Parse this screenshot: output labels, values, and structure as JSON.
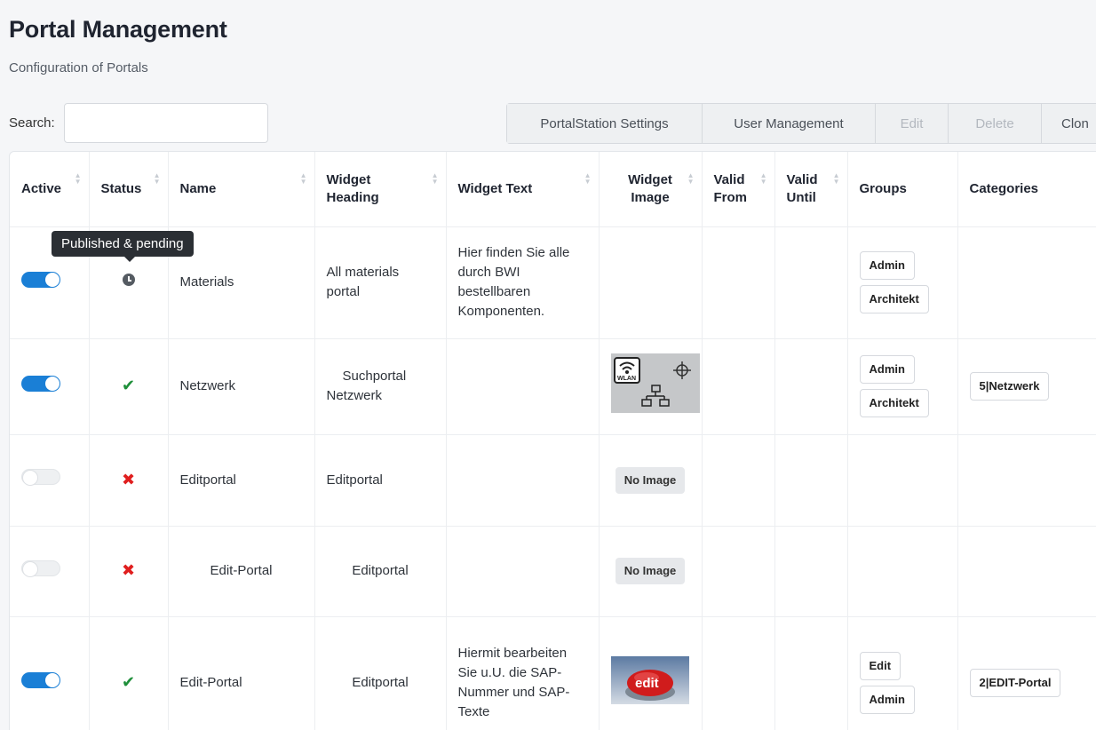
{
  "header": {
    "title": "Portal Management",
    "subtitle": "Configuration of Portals"
  },
  "search": {
    "label": "Search:",
    "value": "",
    "placeholder": ""
  },
  "toolbar": {
    "portalstation_settings": "PortalStation Settings",
    "user_management": "User Management",
    "edit": "Edit",
    "delete": "Delete",
    "clone": "Clon"
  },
  "table": {
    "columns": {
      "active": "Active",
      "status": "Status",
      "name": "Name",
      "widget_heading": "Widget Heading",
      "widget_text": "Widget Text",
      "widget_image": "Widget Image",
      "valid_from": "Valid From",
      "valid_until": "Valid Until",
      "groups": "Groups",
      "categories": "Categories"
    },
    "rows": [
      {
        "active": true,
        "status": "pending",
        "name": "Materials",
        "widget_heading": "All materials portal",
        "widget_text": "Hier finden Sie alle durch BWI bestellbaren Komponenten.",
        "widget_image": "",
        "valid_from": "",
        "valid_until": "",
        "groups": [
          "Admin",
          "Architekt"
        ],
        "categories": []
      },
      {
        "active": true,
        "status": "published",
        "name": "Netzwerk",
        "widget_heading": "Suchportal Netzwerk",
        "widget_text": "",
        "widget_image": "WLAN",
        "valid_from": "",
        "valid_until": "",
        "groups": [
          "Admin",
          "Architekt"
        ],
        "categories": [
          "5|Netzwerk"
        ]
      },
      {
        "active": false,
        "status": "unpublished",
        "name": "Editportal",
        "widget_heading": "Editportal",
        "widget_text": "",
        "widget_image": "No Image",
        "valid_from": "",
        "valid_until": "",
        "groups": [],
        "categories": []
      },
      {
        "active": false,
        "status": "unpublished",
        "name": "Edit-Portal",
        "widget_heading": "Editportal",
        "widget_text": "",
        "widget_image": "No Image",
        "valid_from": "",
        "valid_until": "",
        "groups": [],
        "categories": []
      },
      {
        "active": true,
        "status": "published",
        "name": "Edit-Portal",
        "widget_heading": "Editportal",
        "widget_text": "Hiermit bearbeiten Sie u.U. die SAP-Nummer und SAP-Texte",
        "widget_image": "edit",
        "valid_from": "",
        "valid_until": "",
        "groups": [
          "Edit",
          "Admin"
        ],
        "categories": [
          "2|EDIT-Portal"
        ]
      }
    ]
  },
  "tooltip": {
    "text": "Published & pending"
  },
  "icons": {
    "sort": "sort-icon",
    "pending": "clock-icon",
    "published": "check-icon",
    "unpublished": "cross-icon"
  },
  "colors": {
    "toggle_on": "#1a7fd6",
    "status_ok": "#1e8f3a",
    "status_error": "#e01e1e",
    "tooltip_bg": "#2b2f34"
  }
}
